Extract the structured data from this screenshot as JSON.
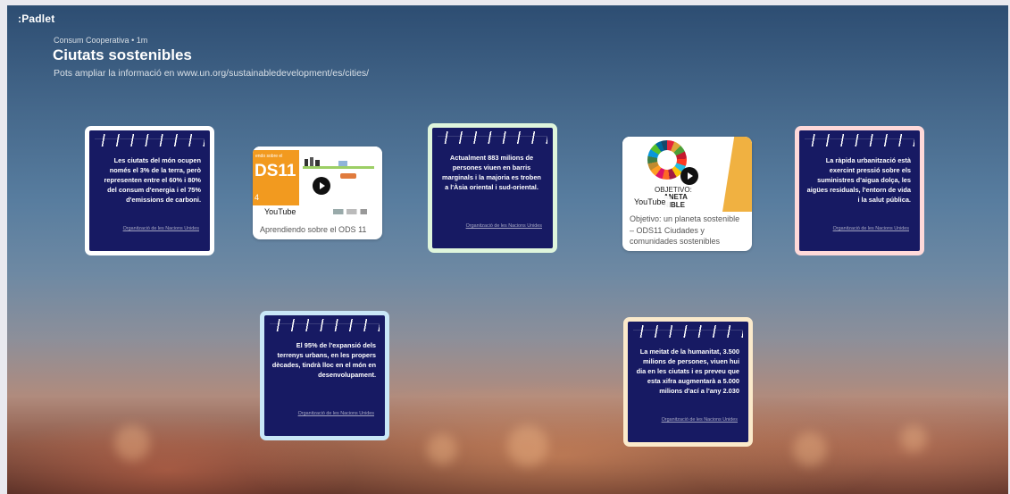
{
  "header": {
    "logo": ":Padlet",
    "author": "Consum Cooperativa",
    "time": "1m",
    "title": "Ciutats sostenibles",
    "subtitle": "Pots ampliar la informació en www.un.org/sustainabledevelopment/es/cities/"
  },
  "notes": [
    {
      "text": "Les ciutats del món ocupen només el 3% de la terra, però representen entre el 60% i 80% del consum d'energia i el 75% d'emissions de carboni.",
      "source": "Organització de les Nacions Unides",
      "border": "#ffffff"
    },
    {
      "text": "Actualment  883 milions de persones viuen en barris marginals i la majoria es troben a l'Àsia oriental i sud-oriental.",
      "source": "Organització de les Nacions Unides",
      "border": "#dff5dc"
    },
    {
      "text": "La ràpida urbanització està exercint pressió sobre els suministres d'aigua dolça, les aigües residuals, l'entorn de vida i la salut pública.",
      "source": "Organització de les Nacions Unides",
      "border": "#ffd9d9"
    },
    {
      "text": "El 95% de l'expansió dels terrenys urbans, en les propers dècades, tindrà lloc en el món en desenvolupament.",
      "source": "Organització de les Nacions Unides",
      "border": "#c9e7f7"
    },
    {
      "text": "La meitat de la humanitat, 3.500 milions de persones, viuen hui dia en les ciutats i es preveu que esta xifra augmentarà a 5.000 milions d'ací a l'any 2.030",
      "source": "Organització de les Nacions Unides",
      "border": "#fbeacb"
    }
  ],
  "videos": [
    {
      "chip": "YouTube",
      "thumb_text": "DS11",
      "thumb_small": "endo sobre el",
      "thumb_corner": "4",
      "caption": "Aprendiendo sobre el ODS 11"
    },
    {
      "chip": "YouTube",
      "thumb_text": "OBJETIVO:",
      "thumb_text2": "ANETA",
      "thumb_text3": "NIBLE",
      "caption": "Objetivo: un planeta sostenible – ODS11 Ciudades y comunidades sostenibles"
    }
  ],
  "colors": {
    "note_bg": "#171a63",
    "accent_orange": "#f29a1f"
  }
}
